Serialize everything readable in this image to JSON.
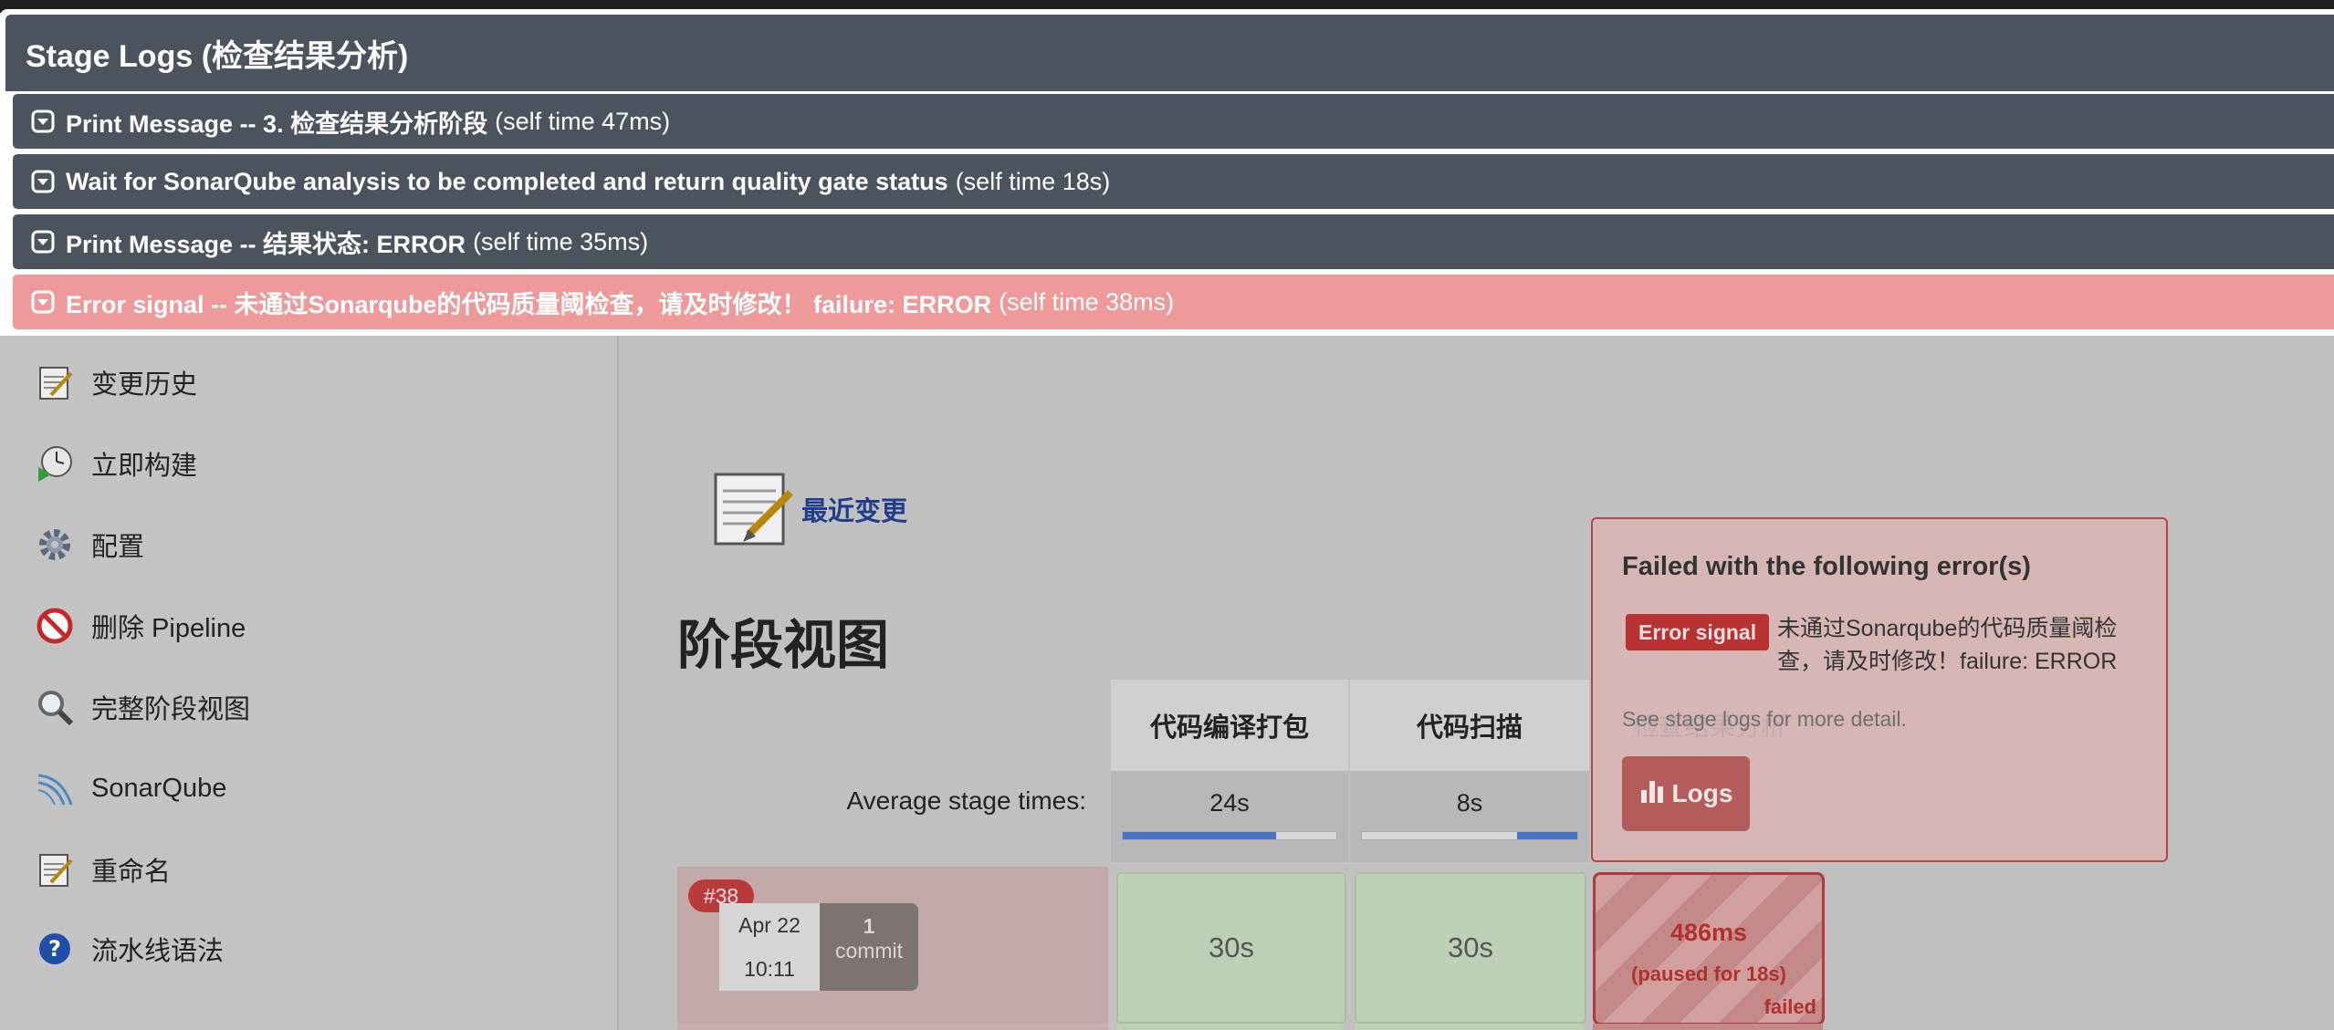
{
  "modal": {
    "title": "Stage Logs (检查结果分析)",
    "rows": [
      {
        "step": "Print Message -- 3. 检查结果分析阶段",
        "time": "(self time 47ms)"
      },
      {
        "step": "Wait for SonarQube analysis to be completed and return quality gate status",
        "time": "(self time 18s)"
      },
      {
        "step": "Print Message -- 结果状态: ERROR",
        "time": "(self time 35ms)"
      },
      {
        "step": "Error signal -- 未通过Sonarqube的代码质量阈检查，请及时修改！ failure: ERROR",
        "time": "(self time 38ms)"
      }
    ]
  },
  "sidebar": {
    "items": [
      {
        "label": "变更历史",
        "icon": "notepad-icon"
      },
      {
        "label": "立即构建",
        "icon": "build-clock-icon"
      },
      {
        "label": "配置",
        "icon": "gear-icon"
      },
      {
        "label": "删除 Pipeline",
        "icon": "prohibited-icon"
      },
      {
        "label": "完整阶段视图",
        "icon": "magnifier-icon"
      },
      {
        "label": "SonarQube",
        "icon": "sonarqube-icon"
      },
      {
        "label": "重命名",
        "icon": "notepad-icon"
      },
      {
        "label": "流水线语法",
        "icon": "help-icon"
      }
    ]
  },
  "main": {
    "recent_changes": "最近变更",
    "stage_view_title": "阶段视图",
    "avg_label": "Average stage times:",
    "stages": [
      {
        "name": "代码编译打包",
        "avg": "24s",
        "avg_fraction": 0.72
      },
      {
        "name": "代码扫描",
        "avg": "8s",
        "avg_fraction": 0.28
      }
    ],
    "run": {
      "number": "#38",
      "date": "Apr 22",
      "time": "10:11",
      "commit_count": "1",
      "commit_label": "commit",
      "cells": [
        "30s",
        "30s"
      ],
      "failed_cell": {
        "duration": "486ms",
        "paused": "(paused for 18s)",
        "status": "failed"
      }
    }
  },
  "error_popover": {
    "header": "Failed with the following error(s)",
    "badge": "Error signal",
    "message": "未通过Sonarqube的代码质量阈检查，请及时修改！failure: ERROR",
    "see_more": "See stage logs for more detail.",
    "logs_button": "Logs",
    "ghost_stage": "检查结果分析"
  },
  "colors": {
    "modal_header": "#4b545e",
    "error_row": "#ef9a9a",
    "error_badge": "#b83232",
    "link": "#1f3d8a"
  }
}
